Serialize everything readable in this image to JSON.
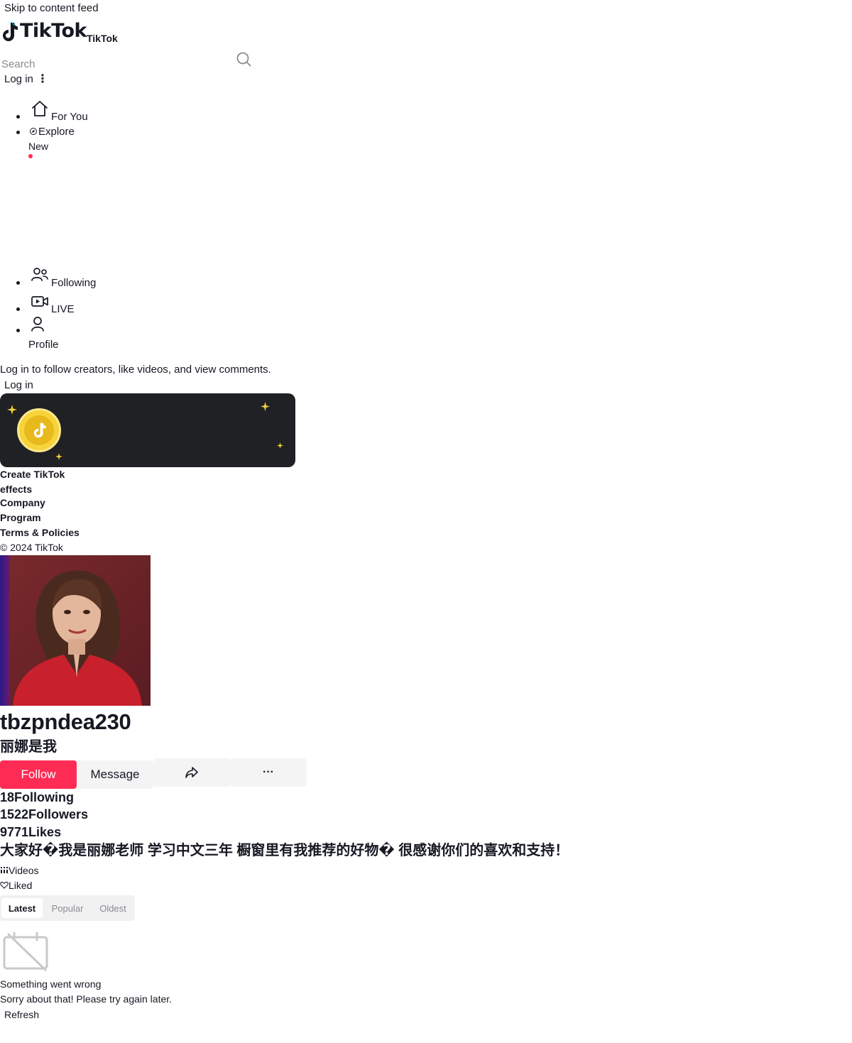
{
  "header": {
    "skip_link": "Skip to content feed",
    "logo_text": "TikTok",
    "logo_caption": "TikTok",
    "search_placeholder": "Search",
    "login_label": "Log in",
    "more_glyph": "⋮"
  },
  "nav": {
    "items": [
      {
        "label": "For You",
        "icon": "home-icon"
      },
      {
        "label": "Explore",
        "icon": "compass-icon",
        "badge": "New"
      },
      {
        "label": "Following",
        "icon": "people-icon"
      },
      {
        "label": "LIVE",
        "icon": "live-camera-icon"
      },
      {
        "label": "Profile",
        "icon": "user-icon"
      }
    ]
  },
  "login_prompt": {
    "text": "Log in to follow creators, like videos, and view comments.",
    "button": "Log in"
  },
  "effects_banner": {
    "icon": "tiktok-coin-icon",
    "colors": {
      "background": "#202124",
      "coin": "#f6d33b",
      "sparkle": "#f6d33b"
    }
  },
  "footer": {
    "links": [
      "Create TikTok",
      "effects",
      "Company",
      "Program",
      "Terms & Policies"
    ],
    "copyright": "© 2024 TikTok"
  },
  "profile": {
    "username": "tbzpndea230",
    "nickname": "丽娜是我",
    "follow_label": "Follow",
    "message_label": "Message",
    "share_icon": "share-icon",
    "more_glyph": "···",
    "stats": [
      {
        "value": "18",
        "label": "Following"
      },
      {
        "value": "1522",
        "label": "Followers"
      },
      {
        "value": "9771",
        "label": "Likes"
      }
    ],
    "bio": "大家好�我是丽娜老师 学习中文三年 橱窗里有我推荐的好物� 很感谢你们的喜欢和支持！",
    "colors": {
      "follow": "#fe2c55",
      "secondary_button": "#f4f4f5"
    }
  },
  "content_tabs": {
    "videos": "Videos",
    "liked": "Liked"
  },
  "sort": {
    "options": [
      "Latest",
      "Popular",
      "Oldest"
    ],
    "selected": "Latest"
  },
  "error": {
    "icon": "empty-calendar-icon",
    "title": "Something went wrong",
    "description": "Sorry about that! Please try again later.",
    "refresh": "Refresh"
  }
}
